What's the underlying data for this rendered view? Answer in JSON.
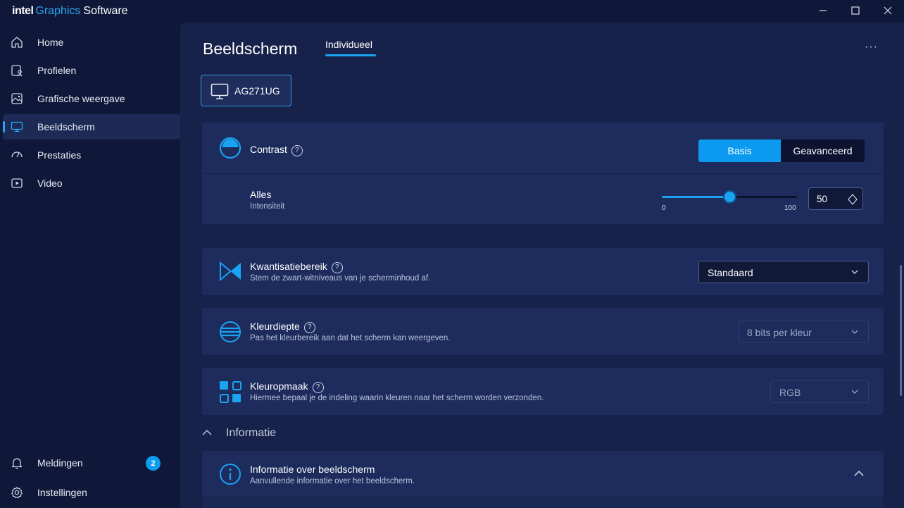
{
  "app": {
    "brand_intel": "intel",
    "brand_graphics": "Graphics",
    "brand_software": "Software"
  },
  "window_controls": [
    "minimize-icon",
    "maximize-icon",
    "close-icon"
  ],
  "sidebar": {
    "items": [
      {
        "label": "Home",
        "icon": "home-icon"
      },
      {
        "label": "Profielen",
        "icon": "profiles-icon"
      },
      {
        "label": "Grafische weergave",
        "icon": "image-icon"
      },
      {
        "label": "Beeldscherm",
        "icon": "monitor-icon",
        "active": true
      },
      {
        "label": "Prestaties",
        "icon": "gauge-icon"
      },
      {
        "label": "Video",
        "icon": "video-icon"
      }
    ],
    "bottom": [
      {
        "label": "Meldingen",
        "icon": "bell-icon",
        "badge": "2"
      },
      {
        "label": "Instellingen",
        "icon": "gear-icon"
      }
    ]
  },
  "header": {
    "title": "Beeldscherm",
    "tab": "Individueel",
    "monitor_name": "AG271UG"
  },
  "contrast": {
    "title": "Contrast",
    "help": "?",
    "modes": [
      "Basis",
      "Geavanceerd"
    ],
    "selected_mode": "Basis",
    "sub_label": "Alles",
    "sub_caption": "Intensiteit",
    "min_label": "0",
    "max_label": "100",
    "min": 0,
    "max": 100,
    "value": 50,
    "value_text": "50"
  },
  "quantization": {
    "title": "Kwantisatiebereik",
    "help": "?",
    "desc": "Stem de zwart-witniveaus van je scherminhoud af.",
    "selected": "Standaard"
  },
  "color_depth": {
    "title": "Kleurdiepte",
    "help": "?",
    "desc": "Pas het kleurbereik aan dat het scherm kan weergeven.",
    "selected": "8 bits per kleur"
  },
  "color_format": {
    "title": "Kleuropmaak",
    "help": "?",
    "desc": "Hiermee bepaal je de indeling waarin kleuren naar het scherm worden verzonden.",
    "selected": "RGB"
  },
  "info_section": {
    "heading": "Informatie",
    "card_title": "Informatie over beeldscherm",
    "card_desc": "Aanvullende informatie over het beeldscherm."
  },
  "colors": {
    "accent": "#1aa3f2",
    "background": "#0f1838",
    "panel": "#17224a",
    "card": "#1d2c5d"
  }
}
